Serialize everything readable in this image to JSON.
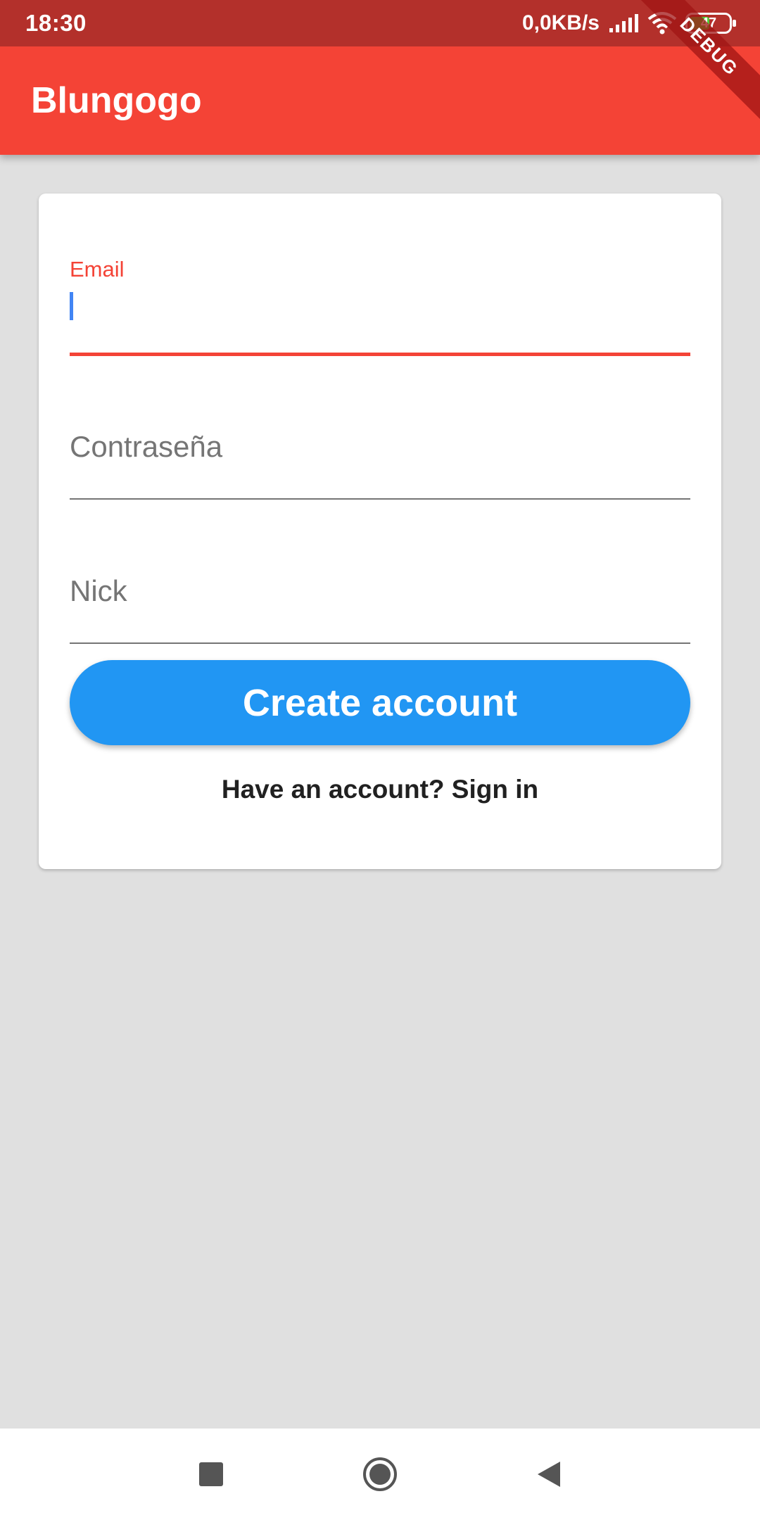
{
  "status_bar": {
    "time": "18:30",
    "network_speed": "0,0KB/s",
    "battery_level": "47",
    "icons": [
      "signal-icon",
      "wifi-icon",
      "battery-icon"
    ]
  },
  "debug_banner": "DEBUG",
  "app_bar": {
    "title": "Blungogo"
  },
  "form": {
    "email": {
      "label": "Email",
      "value": ""
    },
    "password": {
      "placeholder": "Contraseña",
      "value": ""
    },
    "nick": {
      "placeholder": "Nick",
      "value": ""
    },
    "create_button_label": "Create account",
    "signin_link": "Have an account? Sign in"
  },
  "nav_bar": {
    "buttons": [
      "recents-square-icon",
      "home-circle-icon",
      "back-triangle-icon"
    ]
  },
  "colors": {
    "primary": "#f44336",
    "status_bar": "#b3302b",
    "button": "#2196f3",
    "background": "#e0e0e0"
  }
}
